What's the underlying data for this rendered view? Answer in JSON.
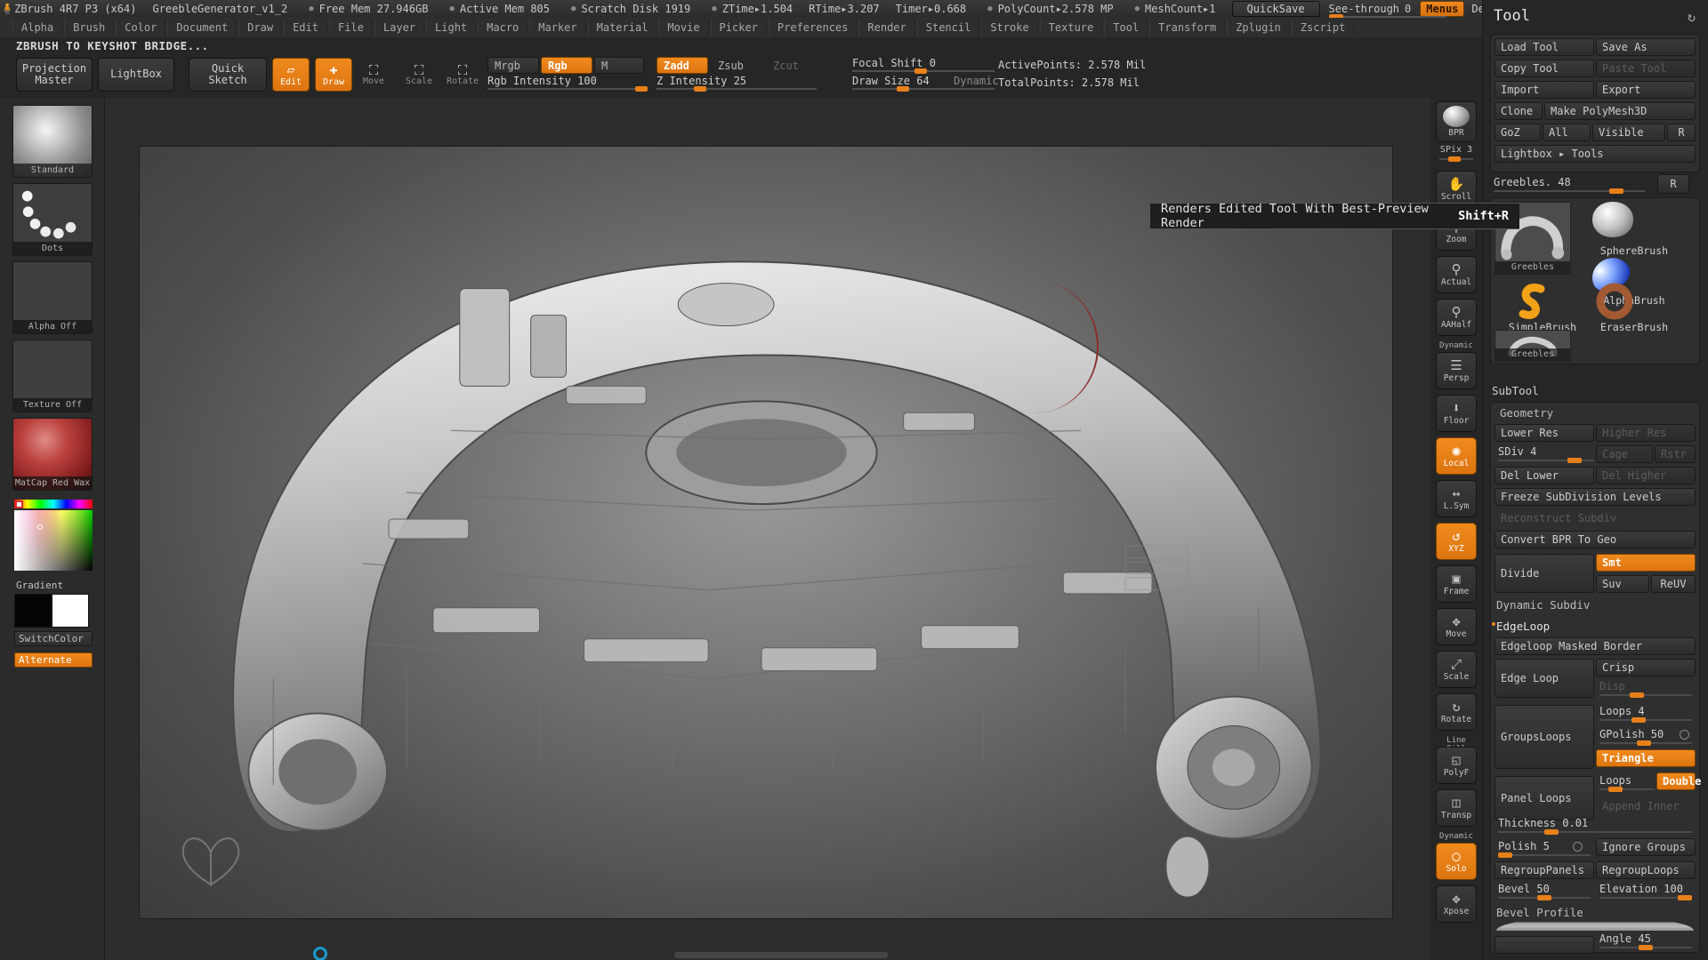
{
  "titlebar": {
    "app": "ZBrush 4R7 P3 (x64)",
    "document": "GreebleGenerator_v1_2",
    "stats": [
      "Free Mem 27.946GB",
      "Active Mem 805",
      "Scratch Disk 1919"
    ],
    "timers": [
      "ZTime▸1.504",
      "RTime▸3.207",
      "Timer▸0.668"
    ],
    "polycount": "PolyCount▸2.578 MP",
    "meshcount": "MeshCount▸1",
    "quicksave": "QuickSave",
    "seethrough_label": "See-through",
    "seethrough_value": "0",
    "menus": "Menus",
    "zscript": "DefaultZScript"
  },
  "menubar": {
    "items": [
      "Alpha",
      "Brush",
      "Color",
      "Document",
      "Draw",
      "Edit",
      "File",
      "Layer",
      "Light",
      "Macro",
      "Marker",
      "Material",
      "Movie",
      "Picker",
      "Preferences",
      "Render",
      "Stencil",
      "Stroke",
      "Texture",
      "Tool",
      "Transform",
      "Zplugin",
      "Zscript"
    ]
  },
  "bridge_label": "ZBRUSH TO KEYSHOT BRIDGE...",
  "shelf": {
    "projection_master": "Projection\nMaster",
    "lightbox": "LightBox",
    "quick_sketch": "Quick\nSketch",
    "edit": "Edit",
    "draw": "Draw",
    "move": "Move",
    "scale": "Scale",
    "rotate": "Rotate",
    "mrgb": "Mrgb",
    "rgb": "Rgb",
    "m": "M",
    "zadd": "Zadd",
    "zsub": "Zsub",
    "zcut": "Zcut",
    "rgb_intensity": "Rgb Intensity 100",
    "z_intensity": "Z Intensity 25",
    "focal_shift": "Focal Shift 0",
    "draw_size": "Draw Size 64",
    "dynamic": "Dynamic",
    "active_points": "ActivePoints: 2.578 Mil",
    "total_points": "TotalPoints: 2.578 Mil"
  },
  "left_tray": {
    "swatches": [
      {
        "name": "Standard",
        "label": "Standard"
      },
      {
        "name": "Dots",
        "label": "Dots"
      },
      {
        "name": "AlphaOff",
        "label": "Alpha Off"
      },
      {
        "name": "TextureOff",
        "label": "Texture Off"
      },
      {
        "name": "MatCapRedWax",
        "label": "MatCap Red Wax"
      }
    ],
    "gradient_label": "Gradient",
    "switch_color": "SwitchColor",
    "alternate": "Alternate"
  },
  "tooltip": {
    "text": "Renders Edited Tool With Best-Preview Render",
    "shortcut": "Shift+R"
  },
  "right_shelf": {
    "bpr": "BPR",
    "spix_label": "SPix",
    "spix_value": "3",
    "buttons": [
      {
        "name": "scroll",
        "label": "Scroll",
        "glyph": "✋",
        "active": false
      },
      {
        "name": "zoom",
        "label": "Zoom",
        "glyph": "⚲",
        "active": false
      },
      {
        "name": "actual",
        "label": "Actual",
        "glyph": "⚲",
        "active": false
      },
      {
        "name": "aahalf",
        "label": "AAHalf",
        "glyph": "⚲",
        "active": false
      },
      {
        "name": "persp",
        "label": "Persp",
        "top": "Dynamic",
        "glyph": "☰",
        "active": false
      },
      {
        "name": "floor",
        "label": "Floor",
        "glyph": "⬇",
        "active": false
      },
      {
        "name": "local",
        "label": "Local",
        "glyph": "◉",
        "active": true
      },
      {
        "name": "lsym",
        "label": "L.Sym",
        "glyph": "↔",
        "active": false
      },
      {
        "name": "xyz",
        "label": "XYZ",
        "glyph": "↺",
        "active": true
      },
      {
        "name": "frame",
        "label": "Frame",
        "glyph": "▣",
        "active": false
      },
      {
        "name": "move",
        "label": "Move",
        "glyph": "✥",
        "active": false
      },
      {
        "name": "scale",
        "label": "Scale",
        "glyph": "⤢",
        "active": false
      },
      {
        "name": "rotate",
        "label": "Rotate",
        "glyph": "↻",
        "active": false
      },
      {
        "name": "polyf",
        "label": "PolyF",
        "top": "Line Fill",
        "glyph": "◱",
        "active": false
      },
      {
        "name": "transp",
        "label": "Transp",
        "glyph": "◫",
        "active": false
      },
      {
        "name": "solo",
        "label": "Solo",
        "top": "Dynamic",
        "glyph": "◯",
        "active": true
      },
      {
        "name": "xpose",
        "label": "Xpose",
        "glyph": "✥",
        "active": false
      }
    ]
  },
  "tool_panel": {
    "title": "Tool",
    "row1": [
      "Load Tool",
      "Save As"
    ],
    "row2": [
      "Copy Tool",
      "Paste Tool"
    ],
    "row3": [
      "Import",
      "Export"
    ],
    "row4": [
      "Clone",
      "Make PolyMesh3D"
    ],
    "row5": [
      "GoZ",
      "All",
      "Visible",
      "R"
    ],
    "lightbox_tools": "Lightbox ▸ Tools",
    "greebles_slider_label": "Greebles. 48",
    "greebles_r": "R",
    "thumbs": [
      {
        "name": "greebles-large",
        "label": "Greebles"
      },
      {
        "name": "spherebrush",
        "label": "SphereBrush"
      },
      {
        "name": "alphabrush",
        "label": "AlphaBrush"
      },
      {
        "name": "simplebrush",
        "label": "SimpleBrush"
      },
      {
        "name": "eraserbrush",
        "label": "EraserBrush"
      },
      {
        "name": "greebles-small",
        "label": "Greebles"
      }
    ],
    "subtool": "SubTool",
    "geometry": "Geometry",
    "lower_res": "Lower Res",
    "higher_res": "Higher Res",
    "sdiv": "SDiv 4",
    "cage": "Cage",
    "rstr": "Rstr",
    "del_lower": "Del Lower",
    "del_higher": "Del Higher",
    "freeze_subdiv": "Freeze SubDivision Levels",
    "reconstruct_subdiv": "Reconstruct Subdiv",
    "convert_bpr": "Convert BPR To Geo",
    "divide": "Divide",
    "smt": "Smt",
    "suv": "Suv",
    "reuv": "ReUV",
    "dynamic_subdiv": "Dynamic Subdiv",
    "edgeloop": "EdgeLoop",
    "edgeloop_masked_border": "Edgeloop Masked Border",
    "edge_loop": "Edge Loop",
    "crisp": "Crisp",
    "disp": "Disp",
    "groupsloops": "GroupsLoops",
    "loops4": "Loops 4",
    "gpolish": "GPolish 50",
    "triangle": "Triangle",
    "panel_loops": "Panel Loops",
    "loops": "Loops",
    "double": "Double",
    "append_inner": "Append Inner",
    "thickness": "Thickness 0.01",
    "polish": "Polish 5",
    "ignore_groups": "Ignore Groups",
    "regroup_panels": "RegroupPanels",
    "regroup_loops": "RegroupLoops",
    "bevel": "Bevel 50",
    "elevation": "Elevation 100",
    "bevel_profile": "Bevel Profile",
    "angle": "Angle 45"
  }
}
